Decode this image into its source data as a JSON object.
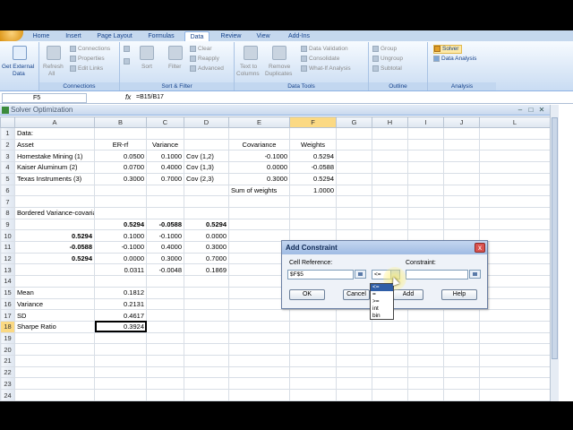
{
  "tabs": [
    "Home",
    "Insert",
    "Page Layout",
    "Formulas",
    "Data",
    "Review",
    "View",
    "Add-Ins"
  ],
  "active_tab": "Data",
  "ribbon": {
    "get_external": "Get External Data",
    "get_external_line1": "Get External",
    "get_external_line2": "Data",
    "connections_group": {
      "label": "Connections",
      "refresh_line1": "Refresh",
      "refresh_line2": "All",
      "connections": "Connections",
      "properties": "Properties",
      "edit_links": "Edit Links"
    },
    "sort_group": {
      "label": "Sort & Filter",
      "sort": "Sort",
      "filter": "Filter",
      "clear": "Clear",
      "reapply": "Reapply",
      "advanced": "Advanced"
    },
    "tools_group": {
      "label": "Data Tools",
      "text_line1": "Text to",
      "text_line2": "Columns",
      "remove_line1": "Remove",
      "remove_line2": "Duplicates",
      "validation": "Data Validation",
      "consolidate": "Consolidate",
      "whatif": "What-If Analysis"
    },
    "outline_group": {
      "label": "Outline",
      "group": "Group",
      "ungroup": "Ungroup",
      "subtotal": "Subtotal"
    },
    "analysis_group": {
      "label": "Analysis",
      "solver": "Solver",
      "data_analysis": "Data Analysis"
    }
  },
  "formula_bar": {
    "name_box": "F5",
    "fx": "fx",
    "formula": "=B15/B17"
  },
  "workbook_title": "Solver Optimization",
  "columns": [
    "A",
    "B",
    "C",
    "D",
    "E",
    "F",
    "G",
    "H",
    "I",
    "J",
    "L"
  ],
  "rows": [
    {
      "n": "1",
      "cells": [
        "Data:",
        "",
        "",
        "",
        "",
        "",
        "",
        "",
        "",
        "",
        ""
      ]
    },
    {
      "n": "2",
      "cells": [
        "Asset",
        "ER-rf",
        "Variance",
        "",
        "Covariance",
        "Weights",
        "",
        "",
        "",
        "",
        ""
      ]
    },
    {
      "n": "3",
      "cells": [
        "Homestake Mining (1)",
        "0.0500",
        "0.1000",
        "Cov (1,2)",
        "-0.1000",
        "0.5294",
        "",
        "",
        "",
        "",
        ""
      ]
    },
    {
      "n": "4",
      "cells": [
        "Kaiser Aluminum (2)",
        "0.0700",
        "0.4000",
        "Cov (1,3)",
        "0.0000",
        "-0.0588",
        "",
        "",
        "",
        "",
        ""
      ]
    },
    {
      "n": "5",
      "cells": [
        "Texas Instruments (3)",
        "0.3000",
        "0.7000",
        "Cov (2,3)",
        "0.3000",
        "0.5294",
        "",
        "",
        "",
        "",
        ""
      ]
    },
    {
      "n": "6",
      "cells": [
        "",
        "",
        "",
        "",
        "Sum of weights",
        "1.0000",
        "",
        "",
        "",
        "",
        ""
      ]
    },
    {
      "n": "7",
      "cells": [
        "",
        "",
        "",
        "",
        "",
        "",
        "",
        "",
        "",
        "",
        ""
      ]
    },
    {
      "n": "8",
      "cells": [
        "Bordered Variance-covariance Matrix",
        "",
        "",
        "",
        "",
        "",
        "",
        "",
        "",
        "",
        ""
      ]
    },
    {
      "n": "9",
      "cells": [
        "",
        "0.5294",
        "-0.0588",
        "0.5294",
        "",
        "",
        "",
        "",
        "",
        "",
        ""
      ]
    },
    {
      "n": "10",
      "cells": [
        "0.5294",
        "0.1000",
        "-0.1000",
        "0.0000",
        "",
        "",
        "",
        "",
        "",
        "",
        ""
      ]
    },
    {
      "n": "11",
      "cells": [
        "-0.0588",
        "-0.1000",
        "0.4000",
        "0.3000",
        "",
        "",
        "",
        "",
        "",
        "",
        ""
      ]
    },
    {
      "n": "12",
      "cells": [
        "0.5294",
        "0.0000",
        "0.3000",
        "0.7000",
        "",
        "",
        "",
        "",
        "",
        "",
        ""
      ]
    },
    {
      "n": "13",
      "cells": [
        "",
        "0.0311",
        "-0.0048",
        "0.1869",
        "",
        "",
        "",
        "",
        "",
        "",
        ""
      ]
    },
    {
      "n": "14",
      "cells": [
        "",
        "",
        "",
        "",
        "",
        "",
        "",
        "",
        "",
        "",
        ""
      ]
    },
    {
      "n": "15",
      "cells": [
        "Mean",
        "0.1812",
        "",
        "",
        "",
        "",
        "",
        "",
        "",
        "",
        ""
      ]
    },
    {
      "n": "16",
      "cells": [
        "Variance",
        "0.2131",
        "",
        "",
        "",
        "",
        "",
        "",
        "",
        "",
        ""
      ]
    },
    {
      "n": "17",
      "cells": [
        "SD",
        "0.4617",
        "",
        "",
        "",
        "",
        "",
        "",
        "",
        "",
        ""
      ]
    },
    {
      "n": "18",
      "cells": [
        "Sharpe Ratio",
        "0.3924",
        "",
        "",
        "",
        "",
        "",
        "",
        "",
        "",
        ""
      ]
    },
    {
      "n": "19",
      "cells": [
        "",
        "",
        "",
        "",
        "",
        "",
        "",
        "",
        "",
        "",
        ""
      ]
    },
    {
      "n": "20",
      "cells": [
        "",
        "",
        "",
        "",
        "",
        "",
        "",
        "",
        "",
        "",
        ""
      ]
    },
    {
      "n": "21",
      "cells": [
        "",
        "",
        "",
        "",
        "",
        "",
        "",
        "",
        "",
        "",
        ""
      ]
    },
    {
      "n": "22",
      "cells": [
        "",
        "",
        "",
        "",
        "",
        "",
        "",
        "",
        "",
        "",
        ""
      ]
    },
    {
      "n": "23",
      "cells": [
        "",
        "",
        "",
        "",
        "",
        "",
        "",
        "",
        "",
        "",
        ""
      ]
    },
    {
      "n": "24",
      "cells": [
        "",
        "",
        "",
        "",
        "",
        "",
        "",
        "",
        "",
        "",
        ""
      ]
    }
  ],
  "dialog": {
    "title": "Add Constraint",
    "close": "x",
    "cell_ref_label": "Cell Reference:",
    "cell_ref_value": "$F$5",
    "constraint_label": "Constraint:",
    "operator_value": "<=",
    "constraint_value": "",
    "ok": "OK",
    "cancel": "Cancel",
    "add": "Add",
    "help": "Help",
    "operator_options": [
      "<=",
      "=",
      ">=",
      "int",
      "bin"
    ]
  }
}
